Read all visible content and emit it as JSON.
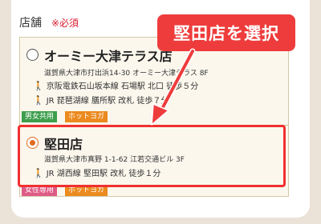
{
  "section": {
    "label": "店舗",
    "required": "※必須"
  },
  "callout": "堅田店を選択",
  "shops": [
    {
      "name": "オーミー大津テラス店",
      "address": "滋賀県大津市打出浜14-30 オーミー大津テラス 8F",
      "access": [
        "京阪電鉄石山坂本線 石場駅 北口 徒歩５分",
        "JR 琵琶湖線 膳所駅 改札 徒歩７分"
      ],
      "tags": [
        "男女共用",
        "ホットヨガ"
      ],
      "selected": false
    },
    {
      "name": "堅田店",
      "address": "滋賀県大津市真野 1-1-62 江若交通ビル 3F",
      "access": [
        "JR 湖西線 堅田駅 改札 徒歩１分"
      ],
      "tags": [
        "女性専用",
        "ホットヨガ"
      ],
      "selected": true
    }
  ],
  "icons": {
    "access": "walking-person-icon"
  },
  "colors": {
    "accent": "#ee3c3c",
    "radio_checked": "#e06a22",
    "tag_green": "#3e9e4c",
    "tag_orange": "#eb8a1e",
    "tag_pink": "#de5b87"
  }
}
